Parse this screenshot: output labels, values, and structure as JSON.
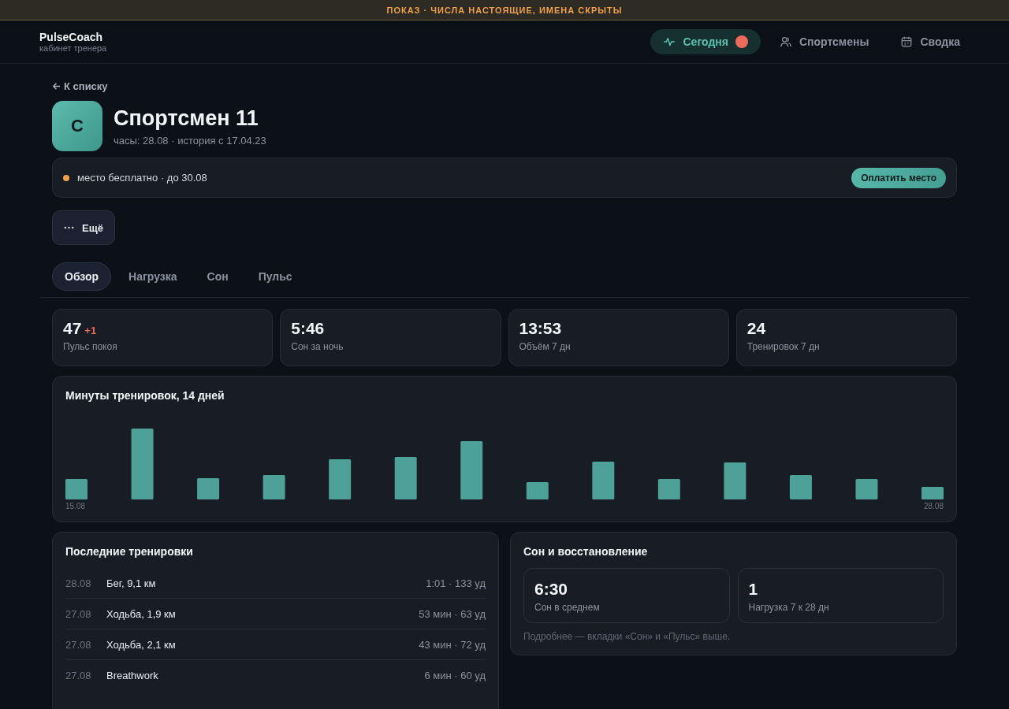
{
  "banner": "ПОКАЗ · ЧИСЛА НАСТОЯЩИЕ, ИМЕНА СКРЫТЫ",
  "brand": {
    "name": "PulseCoach",
    "subtitle": "кабинет тренера"
  },
  "nav": [
    {
      "label": "Сегодня",
      "kind": "pulse",
      "selected": true,
      "alert": true
    },
    {
      "label": "Спортсмены",
      "kind": "people",
      "selected": false,
      "alert": false
    },
    {
      "label": "Сводка",
      "kind": "calendar",
      "selected": false,
      "alert": false
    }
  ],
  "back_link": "К списку",
  "athlete": {
    "initial": "С",
    "name": "Спортсмен 11",
    "meta": "часы: 28.08 · история с 17.04.23"
  },
  "notice": {
    "text": "место бесплатно · до 30.08",
    "color": "#f0a04b",
    "button": "Оплатить место"
  },
  "more_button": "Ещё",
  "tabs": [
    {
      "label": "Обзор",
      "selected": true
    },
    {
      "label": "Нагрузка",
      "selected": false
    },
    {
      "label": "Сон",
      "selected": false
    },
    {
      "label": "Пульс",
      "selected": false
    }
  ],
  "stats": [
    {
      "value": "47",
      "delta": "+1",
      "label": "Пульс покоя"
    },
    {
      "value": "5:46",
      "label": "Сон за ночь"
    },
    {
      "value": "13:53",
      "label": "Объём 7 дн"
    },
    {
      "value": "24",
      "label": "Тренировок 7 дн"
    }
  ],
  "minutes_chart": {
    "title": "Минуты тренировок, 14 дней",
    "start_label": "15.08",
    "end_label": "28.08"
  },
  "workouts": {
    "title": "Последние тренировки",
    "rows": [
      {
        "date": "28.08",
        "name": "Бег, 9,1 км",
        "summary": "1:01 · 133 уд"
      },
      {
        "date": "27.08",
        "name": "Ходьба, 1,9 км",
        "summary": "53 мин · 63 уд"
      },
      {
        "date": "27.08",
        "name": "Ходьба, 2,1 км",
        "summary": "43 мин · 72 уд"
      },
      {
        "date": "27.08",
        "name": "Breathwork",
        "summary": "6 мин · 60 уд"
      }
    ]
  },
  "recovery": {
    "title": "Сон и восстановление",
    "stats": [
      {
        "value": "6:30",
        "label": "Сон в среднем"
      },
      {
        "value": "1",
        "label": "Нагрузка 7 к 28 дн"
      }
    ],
    "note": "Подробнее — вкладки «Сон» и «Пульс» выше."
  }
}
